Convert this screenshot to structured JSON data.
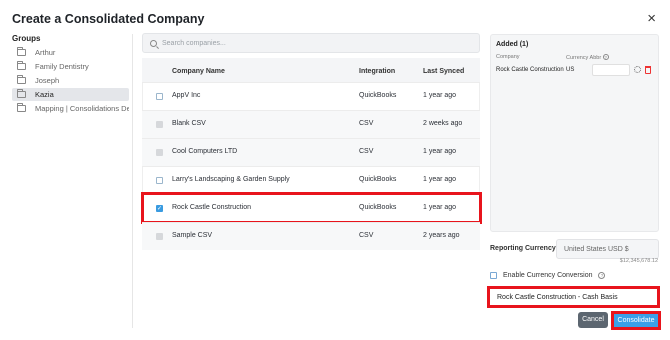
{
  "dialog": {
    "title": "Create a Consolidated Company",
    "close_label": "×"
  },
  "groups": {
    "label": "Groups",
    "items": [
      {
        "label": "Arthur",
        "active": false
      },
      {
        "label": "Family Dentistry",
        "active": false
      },
      {
        "label": "Joseph",
        "active": false
      },
      {
        "label": "Kazia",
        "active": true
      },
      {
        "label": "Mapping | Consolidations Den",
        "active": false
      }
    ]
  },
  "search": {
    "placeholder": "Search companies..."
  },
  "table": {
    "headers": {
      "company": "Company Name",
      "integration": "Integration",
      "last_synced": "Last Synced"
    },
    "rows": [
      {
        "company": "AppV Inc",
        "integration": "QuickBooks",
        "last_synced": "1 year ago",
        "checkbox": "empty"
      },
      {
        "company": "Blank CSV",
        "integration": "CSV",
        "last_synced": "2 weeks ago",
        "checkbox": "disabled"
      },
      {
        "company": "Cool Computers LTD",
        "integration": "CSV",
        "last_synced": "1 year ago",
        "checkbox": "disabled"
      },
      {
        "company": "Larry's Landscaping & Garden Supply",
        "integration": "QuickBooks",
        "last_synced": "1 year ago",
        "checkbox": "empty"
      },
      {
        "company": "Rock Castle Construction",
        "integration": "QuickBooks",
        "last_synced": "1 year ago",
        "checkbox": "checked"
      },
      {
        "company": "Sample CSV",
        "integration": "CSV",
        "last_synced": "2 years ago",
        "checkbox": "disabled"
      }
    ]
  },
  "added": {
    "title": "Added (1)",
    "col_company": "Company",
    "col_currency": "Currency Abbr",
    "items": [
      {
        "company": "Rock Castle Construction",
        "currency": "US"
      }
    ]
  },
  "reporting": {
    "label": "Reporting Currency",
    "value": "United States USD $",
    "amount": "$12,345,678.12"
  },
  "conversion": {
    "label": "Enable Currency Conversion"
  },
  "name_input": {
    "value": "Rock Castle Construction - Cash Basis"
  },
  "buttons": {
    "cancel": "Cancel",
    "consolidate": "Consolidate"
  },
  "colors": {
    "accent": "#3aa0e8",
    "highlight": "#e8141c"
  }
}
